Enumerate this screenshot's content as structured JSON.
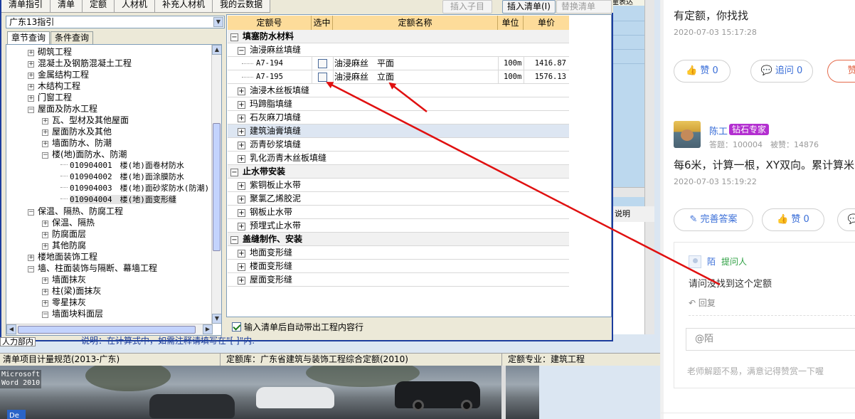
{
  "menu": {
    "tabs": [
      "清单指引",
      "清单",
      "定额",
      "人材机",
      "补充人材机",
      "我的云数据"
    ],
    "insert_child": "插入子目",
    "insert_list": "插入清单(I)",
    "replace_list": "替换清单(R)"
  },
  "library": {
    "selected": "广东13指引"
  },
  "subtabs": [
    "章节查询",
    "条件查询"
  ],
  "tree": [
    {
      "level": 1,
      "box": "+",
      "label": "砌筑工程"
    },
    {
      "level": 1,
      "box": "+",
      "label": "混凝土及钢筋混凝土工程"
    },
    {
      "level": 1,
      "box": "+",
      "label": "金属结构工程"
    },
    {
      "level": 1,
      "box": "+",
      "label": "木结构工程"
    },
    {
      "level": 1,
      "box": "+",
      "label": "门窗工程"
    },
    {
      "level": 1,
      "box": "−",
      "label": "屋面及防水工程"
    },
    {
      "level": 2,
      "box": "+",
      "label": "瓦、型材及其他屋面"
    },
    {
      "level": 2,
      "box": "+",
      "label": "屋面防水及其他"
    },
    {
      "level": 2,
      "box": "+",
      "label": "墙面防水、防潮"
    },
    {
      "level": 2,
      "box": "−",
      "label": "楼(地)面防水、防潮"
    },
    {
      "level": 3,
      "box": "",
      "label": "010904001　楼(地)面卷材防水"
    },
    {
      "level": 3,
      "box": "",
      "label": "010904002　楼(地)面涂膜防水"
    },
    {
      "level": 3,
      "box": "",
      "label": "010904003　楼(地)面砂浆防水(防潮)"
    },
    {
      "level": 3,
      "box": "",
      "label": "010904004　楼(地)面变形缝"
    },
    {
      "level": 1,
      "box": "−",
      "label": "保温、隔热、防腐工程"
    },
    {
      "level": 2,
      "box": "+",
      "label": "保温、隔热"
    },
    {
      "level": 2,
      "box": "+",
      "label": "防腐面层"
    },
    {
      "level": 2,
      "box": "+",
      "label": "其他防腐"
    },
    {
      "level": 1,
      "box": "+",
      "label": "楼地面装饰工程"
    },
    {
      "level": 1,
      "box": "−",
      "label": "墙、柱面装饰与隔断、幕墙工程"
    },
    {
      "level": 2,
      "box": "+",
      "label": "墙面抹灰"
    },
    {
      "level": 2,
      "box": "+",
      "label": "柱(梁)面抹灰"
    },
    {
      "level": 2,
      "box": "+",
      "label": "零星抹灰"
    },
    {
      "level": 2,
      "box": "−",
      "label": "墙面块料面层"
    }
  ],
  "grid": {
    "headers": [
      "定额号",
      "选中",
      "定额名称",
      "单位",
      "单价"
    ],
    "rows": [
      {
        "type": "section",
        "box": "−",
        "label": "填塞防水材料"
      },
      {
        "type": "group",
        "box": "−",
        "label": "油浸麻丝填缝"
      },
      {
        "type": "item",
        "code": "A7-194",
        "name": "油浸麻丝　平面",
        "unit": "100m",
        "price": "1416.87"
      },
      {
        "type": "item",
        "code": "A7-195",
        "name": "油浸麻丝　立面",
        "unit": "100m",
        "price": "1576.13"
      },
      {
        "type": "group",
        "box": "+",
        "label": "油浸木丝板填缝"
      },
      {
        "type": "group",
        "box": "+",
        "label": "玛蹄脂填缝"
      },
      {
        "type": "group",
        "box": "+",
        "label": "石灰麻刀填缝"
      },
      {
        "type": "group",
        "box": "+",
        "label": "建筑油膏填缝",
        "highlight": true
      },
      {
        "type": "group",
        "box": "+",
        "label": "沥青砂浆填缝"
      },
      {
        "type": "group",
        "box": "+",
        "label": "乳化沥青木丝板填缝"
      },
      {
        "type": "section",
        "box": "−",
        "label": "止水带安装"
      },
      {
        "type": "group",
        "box": "+",
        "label": "紫铜板止水带"
      },
      {
        "type": "group",
        "box": "+",
        "label": "聚氯乙烯胶泥"
      },
      {
        "type": "group",
        "box": "+",
        "label": "钢板止水带"
      },
      {
        "type": "group",
        "box": "+",
        "label": "预埋式止水带"
      },
      {
        "type": "section",
        "box": "−",
        "label": "盖缝制作、安装"
      },
      {
        "type": "group",
        "box": "+",
        "label": "地面变形缝"
      },
      {
        "type": "group",
        "box": "+",
        "label": "楼面变形缝"
      },
      {
        "type": "group",
        "box": "+",
        "label": "屋面变形缝"
      }
    ],
    "auto_bring_label": "输入清单后自动带出工程内容行"
  },
  "bg_right": {
    "top_label": "量表达",
    "bar_label": "说明"
  },
  "behind": {
    "left_label": "人力部内",
    "note": "说明：在计算式中，如需注释请填写在\"[ ]\"内."
  },
  "statusbar": {
    "spec": "清单项目计量规范(2013-广东)",
    "quota_lib": "定额库：广东省建筑与装饰工程综合定额(2010)",
    "quota_major": "定额专业：建筑工程"
  },
  "desktop": {
    "word_label_1": "Microsoft",
    "word_label_2": "Word 2010",
    "taskbar_label": "De"
  },
  "qa": {
    "answer1_text": "有定额，你找找",
    "answer1_time": "2020-07-03 15:17:28",
    "like1": "赞 0",
    "ask1": "追问 0",
    "red_btn": "赞",
    "expert_name": "陈工",
    "expert_badge": "钻石专家",
    "expert_stats": "答题：100004　被赞：14876",
    "answer2_text": "每6米，计算一根，XY双向。累计算米",
    "answer2_time": "2020-07-03 15:19:22",
    "improve_btn": "完善答案",
    "like2": "赞 0",
    "sub_name": "陌",
    "sub_role": "提问人",
    "sub_text": "请问没找到这个定额",
    "sub_reply": "回复",
    "reply_placeholder": "@陌",
    "sub_footer": "老师解题不易，满意记得赞赏一下喔"
  },
  "colors": {
    "accent": "#3b6fd8",
    "arrow": "#e01010",
    "badge": "#b32fd0",
    "grid_header": "#fddc9a"
  }
}
